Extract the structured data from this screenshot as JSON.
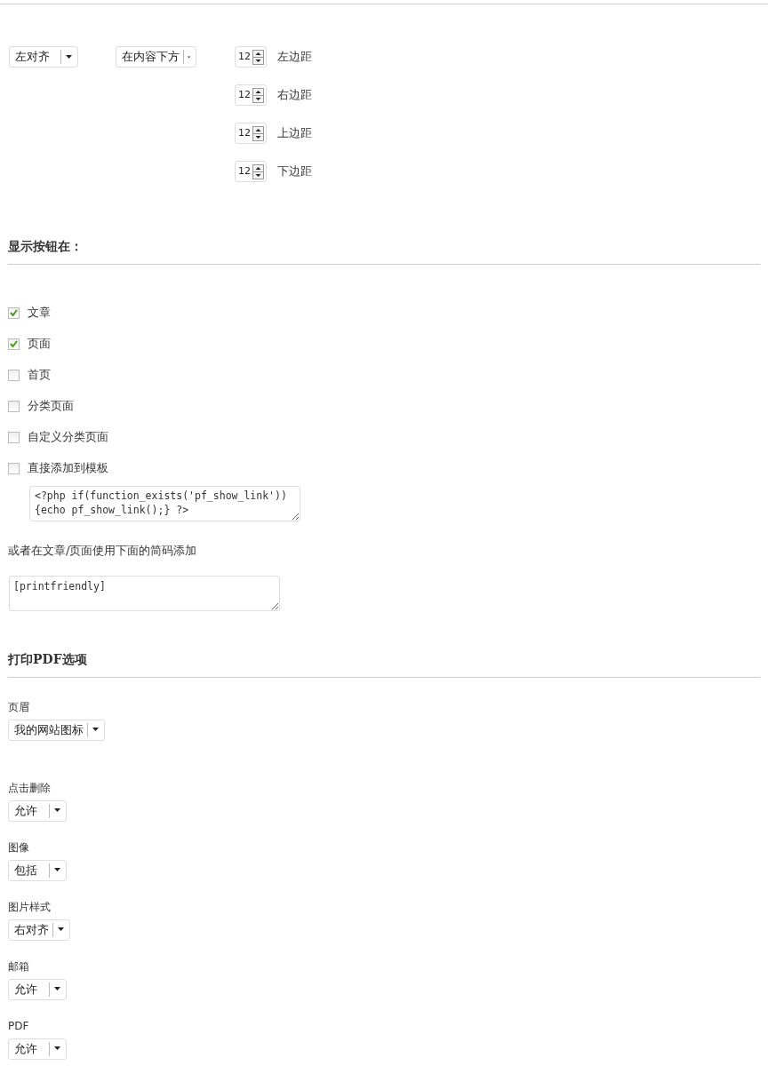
{
  "position": {
    "alignment": {
      "value": "左对齐"
    },
    "placement": {
      "value": "在内容下方"
    },
    "margins": [
      {
        "value": "12",
        "label": "左边距"
      },
      {
        "value": "12",
        "label": "右边距"
      },
      {
        "value": "12",
        "label": "上边距"
      },
      {
        "value": "12",
        "label": "下边距"
      }
    ]
  },
  "show_button": {
    "heading": "显示按钮在：",
    "options": [
      {
        "label": "文章",
        "checked": true
      },
      {
        "label": "页面",
        "checked": true
      },
      {
        "label": "首页",
        "checked": false
      },
      {
        "label": "分类页面",
        "checked": false
      },
      {
        "label": "自定义分类页面",
        "checked": false
      },
      {
        "label": "直接添加到模板",
        "checked": false
      }
    ],
    "template_code": "<?php if(function_exists('pf_show_link'))\n{echo pf_show_link();} ?>",
    "shortcode_note": "或者在文章/页面使用下面的简码添加",
    "shortcode": "[printfriendly]"
  },
  "pdf_options": {
    "heading": "打印PDF选项",
    "fields": [
      {
        "label": "页眉",
        "value": "我的网站图标"
      },
      {
        "label": "点击删除",
        "value": "允许"
      },
      {
        "label": "图像",
        "value": "包括"
      },
      {
        "label": "图片样式",
        "value": "右对齐"
      },
      {
        "label": "邮箱",
        "value": "允许"
      },
      {
        "label": "PDF",
        "value": "允许"
      }
    ]
  }
}
